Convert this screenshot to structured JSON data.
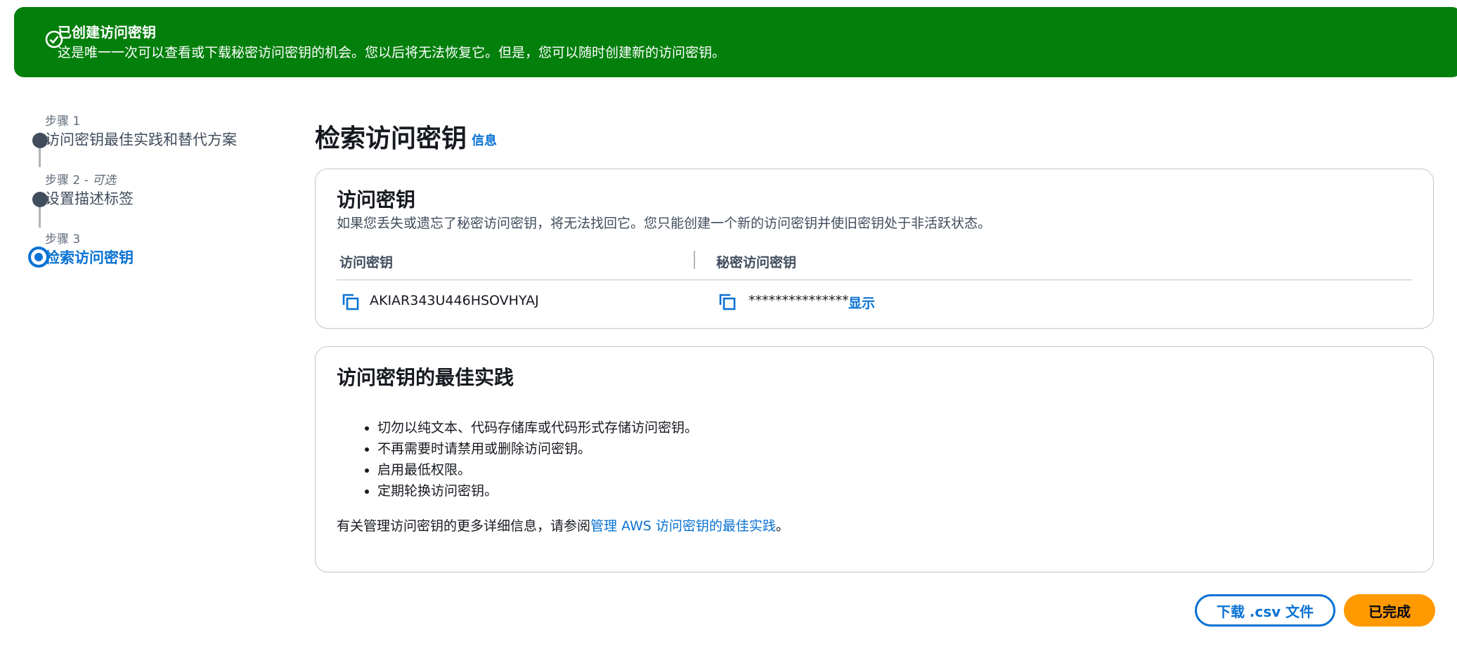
{
  "flash": {
    "title": "已创建访问密钥",
    "message": "这是唯一一次可以查看或下载秘密访问密钥的机会。您以后将无法恢复它。但是，您可以随时创建新的访问密钥。"
  },
  "steps": [
    {
      "label": "步骤 1",
      "optional": "",
      "title": "访问密钥最佳实践和替代方案"
    },
    {
      "label": "步骤 2 - ",
      "optional": "可选",
      "title": "设置描述标签"
    },
    {
      "label": "步骤 3",
      "optional": "",
      "title": "检索访问密钥"
    }
  ],
  "page": {
    "title": "检索访问密钥",
    "info_link": "信息"
  },
  "access_key_card": {
    "heading": "访问密钥",
    "description": "如果您丢失或遗忘了秘密访问密钥，将无法找回它。您只能创建一个新的访问密钥并使旧密钥处于非活跃状态。",
    "col_access_key": "访问密钥",
    "col_secret_key": "秘密访问密钥",
    "access_key_value": "AKIAR343U446HSOVHYAJ",
    "secret_key_masked": "***************",
    "show_label": "显示"
  },
  "best_practices": {
    "heading": "访问密钥的最佳实践",
    "items": [
      "切勿以纯文本、代码存储库或代码形式存储访问密钥。",
      "不再需要时请禁用或删除访问密钥。",
      "启用最低权限。",
      "定期轮换访问密钥。"
    ],
    "more_prefix": "有关管理访问密钥的更多详细信息，请参阅",
    "more_link": "管理 AWS 访问密钥的最佳实践",
    "more_suffix": "。"
  },
  "buttons": {
    "download_csv": "下载 .csv 文件",
    "done": "已完成"
  },
  "colors": {
    "success_green": "#037f0c",
    "link_blue": "#0972d3",
    "primary_orange": "#ff9900"
  },
  "icons": {
    "flash": "check-circle-icon",
    "copy": "copy-icon"
  }
}
